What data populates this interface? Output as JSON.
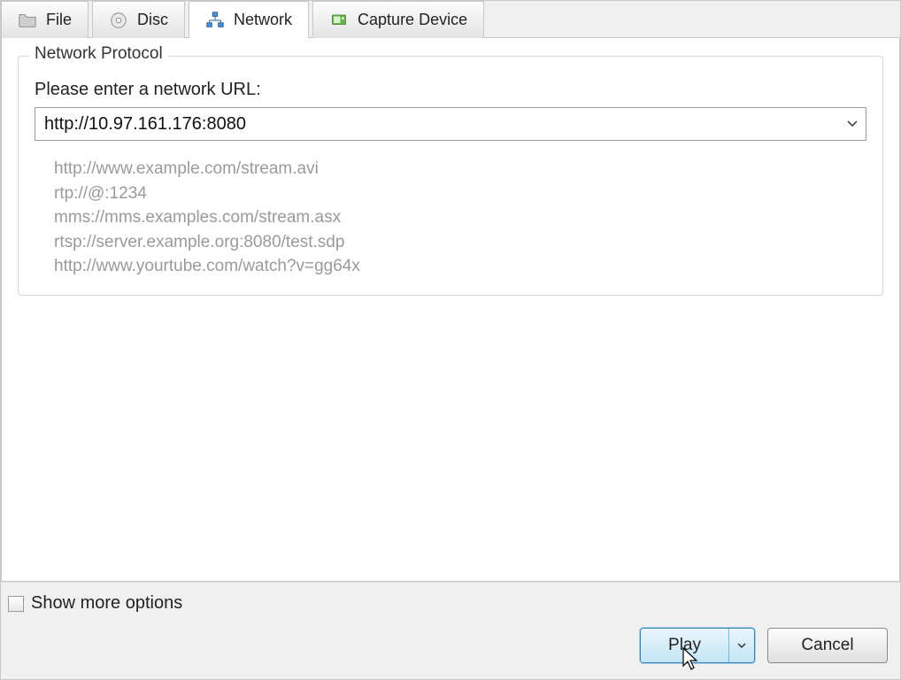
{
  "tabs": {
    "file": {
      "label": "File"
    },
    "disc": {
      "label": "Disc"
    },
    "network": {
      "label": "Network"
    },
    "capture": {
      "label": "Capture Device"
    }
  },
  "network_panel": {
    "group_title": "Network Protocol",
    "prompt": "Please enter a network URL:",
    "url_value": "http://10.97.161.176:8080",
    "examples": [
      "http://www.example.com/stream.avi",
      "rtp://@:1234",
      "mms://mms.examples.com/stream.asx",
      "rtsp://server.example.org:8080/test.sdp",
      "http://www.yourtube.com/watch?v=gg64x"
    ]
  },
  "footer": {
    "show_more_label": "Show more options",
    "show_more_checked": false,
    "play_label": "Play",
    "cancel_label": "Cancel"
  }
}
